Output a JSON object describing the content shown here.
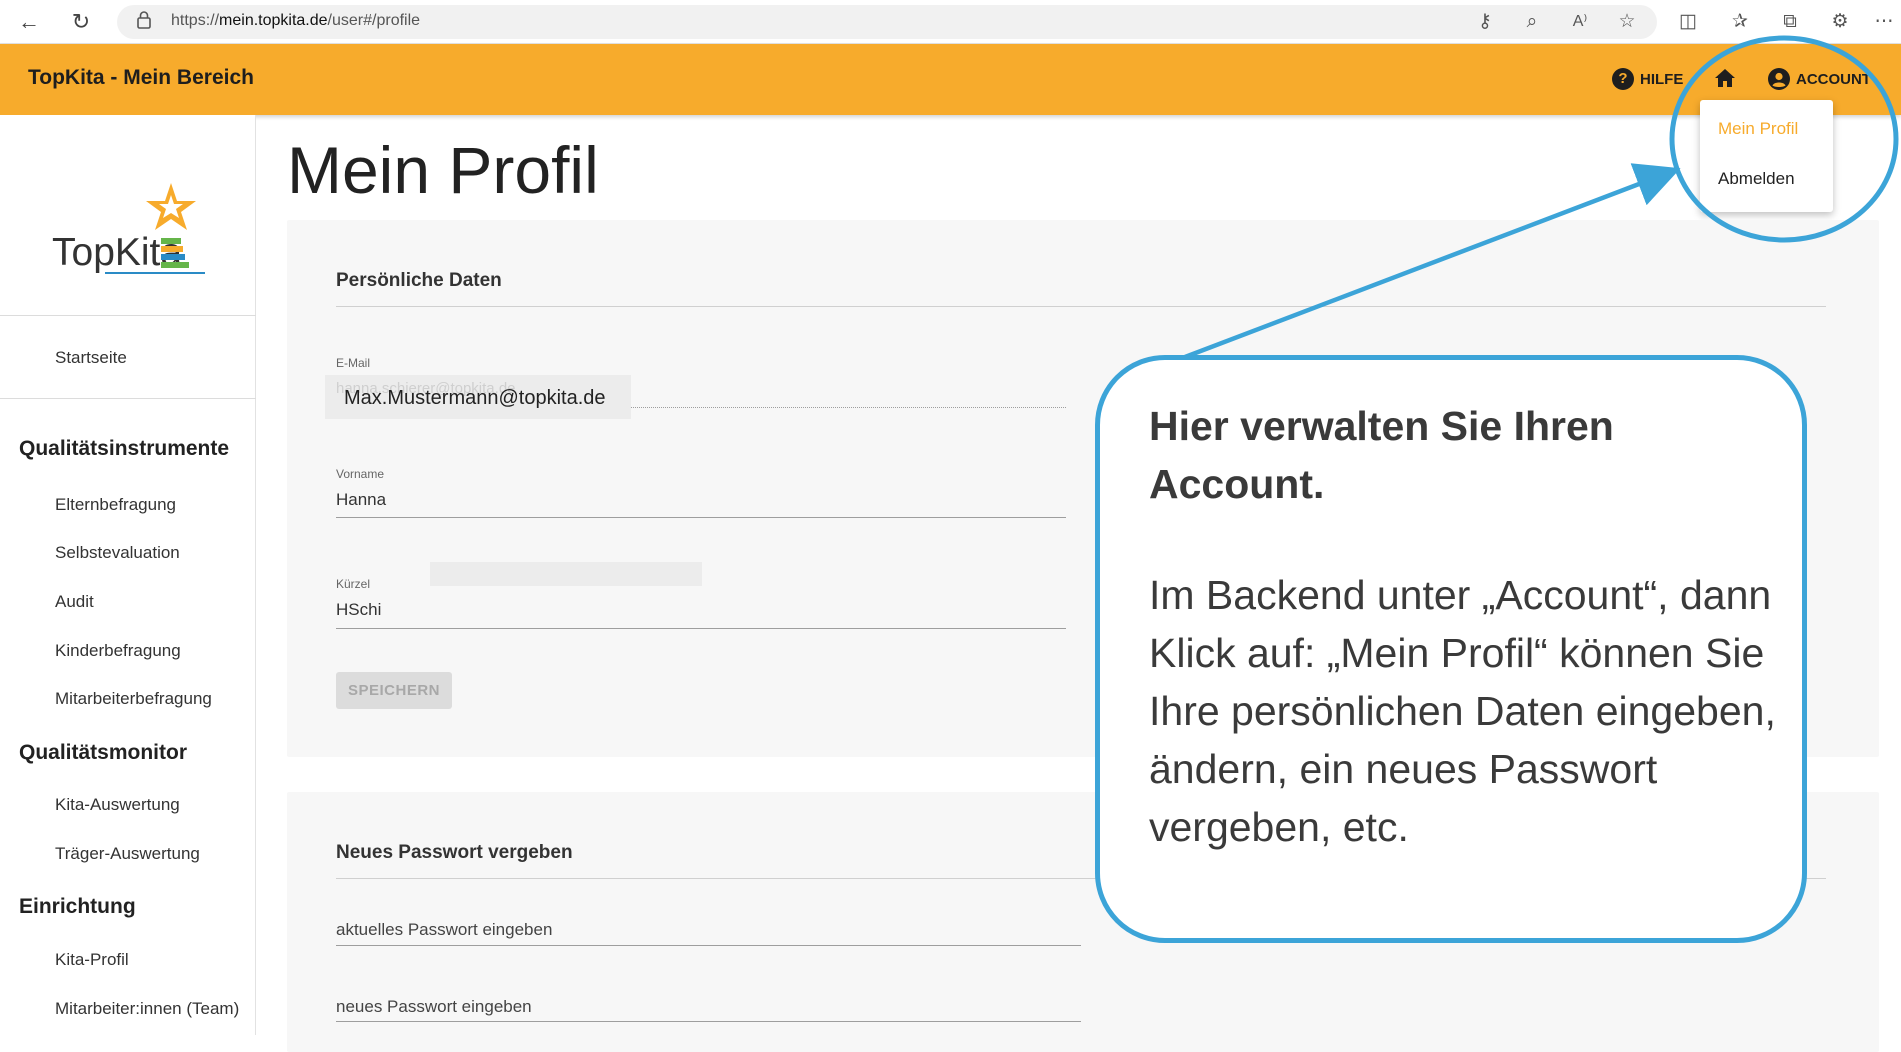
{
  "browser": {
    "url_prefix": "https://",
    "url_domain": "mein.topkita.de",
    "url_path": "/user#/profile",
    "icons": [
      "back-icon",
      "refresh-icon",
      "lock-icon",
      "key-icon",
      "zoom-icon",
      "read-aloud-icon",
      "favorite-star-icon",
      "split-screen-icon",
      "favorites-icon",
      "collections-icon",
      "extensions-icon",
      "more-icon"
    ]
  },
  "header": {
    "title": "TopKita - Mein Bereich",
    "help_label": "HILFE",
    "help_icon": "?",
    "account_label": "ACCOUNT",
    "account_icon": "person"
  },
  "account_menu": {
    "items": [
      {
        "label": "Mein Profil",
        "active": true
      },
      {
        "label": "Abmelden",
        "active": false
      }
    ]
  },
  "sidebar": {
    "logo_text": "TopKita",
    "home": "Startseite",
    "sections": [
      {
        "heading": "Qualitätsinstrumente",
        "items": [
          "Elternbefragung",
          "Selbstevaluation",
          "Audit",
          "Kinderbefragung",
          "Mitarbeiterbefragung"
        ]
      },
      {
        "heading": "Qualitätsmonitor",
        "items": [
          "Kita-Auswertung",
          "Träger-Auswertung"
        ]
      },
      {
        "heading": "Einrichtung",
        "items": [
          "Kita-Profil",
          "Mitarbeiter:innen (Team)"
        ]
      }
    ]
  },
  "main": {
    "page_title": "Mein Profil",
    "personal": {
      "title": "Persönliche Daten",
      "email_label": "E-Mail",
      "email_ghost": "hanna.schierer@topkita.de",
      "email_value": "Max.Mustermann@topkita.de",
      "firstname_label": "Vorname",
      "firstname_value": "Hanna",
      "short_label": "Kürzel",
      "short_value": "HSchi",
      "save_label": "SPEICHERN"
    },
    "password": {
      "title": "Neues Passwort vergeben",
      "current_placeholder": "aktuelles Passwort eingeben",
      "new_placeholder": "neues Passwort eingeben"
    }
  },
  "callout": {
    "heading": "Hier verwalten Sie Ihren Account.",
    "body": "Im Backend unter „Account“, dann Klick auf: „Mein Profil“ können Sie Ihre persönlichen Daten eingeben, ändern, ein neues Passwort vergeben, etc."
  },
  "colors": {
    "brand_orange": "#f7ab2c",
    "annotation_blue": "#3ca4d8",
    "logo_blue": "#2a8bc6",
    "logo_green": "#65b54a"
  }
}
